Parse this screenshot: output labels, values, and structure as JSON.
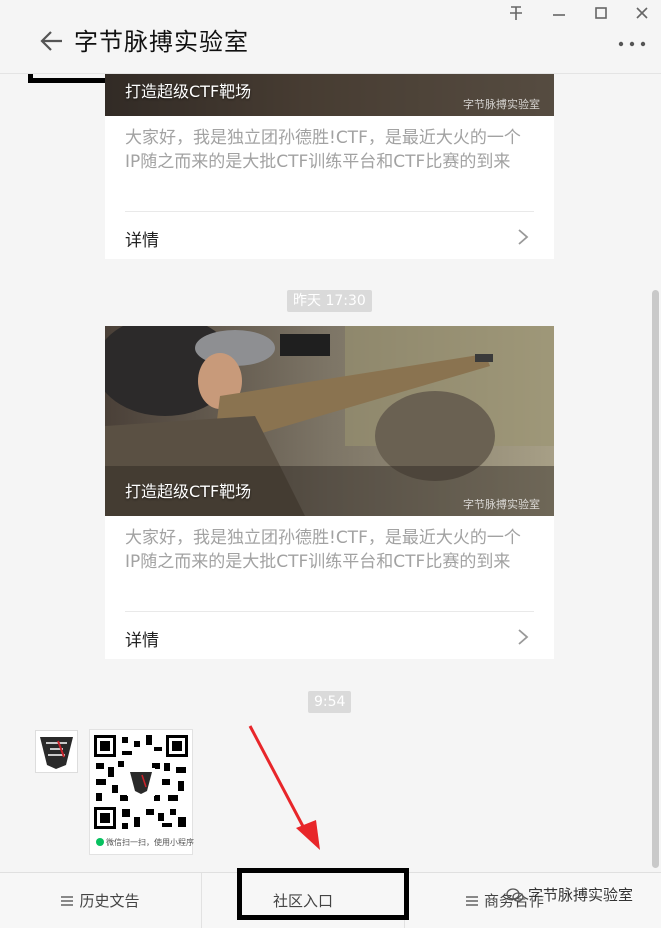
{
  "window": {
    "title": "字节脉搏实验室",
    "pin_icon": "pin-icon",
    "minimize_icon": "minimize-icon",
    "maximize_icon": "maximize-icon",
    "close_icon": "close-icon",
    "back_icon": "back-arrow-icon",
    "more_icon": "more-icon"
  },
  "articles": [
    {
      "caption": "打造超级CTF靶场",
      "watermark": "字节脉搏实验室",
      "description": "大家好，我是独立团孙德胜!CTF，是最近大火的一个IP随之而来的是大批CTF训练平台和CTF比赛的到来",
      "details_label": "详情"
    },
    {
      "timestamp": "昨天 17:30",
      "caption": "打造超级CTF靶场",
      "watermark": "字节脉搏实验室",
      "description": "大家好，我是独立团孙德胜!CTF，是最近大火的一个IP随之而来的是大批CTF训练平台和CTF比赛的到来",
      "details_label": "详情"
    }
  ],
  "qr_message": {
    "timestamp": "9:54",
    "caption": "微信扫一扫，使用小程序"
  },
  "menu": {
    "items": [
      {
        "label": "历史文告"
      },
      {
        "label": "社区入口"
      },
      {
        "label": "商务合作"
      }
    ]
  },
  "brand_watermark": "字节脉搏实验室",
  "colors": {
    "accent_highlight": "#000000",
    "annotation_arrow": "#e8262a",
    "timestamp_bg": "#dadada"
  }
}
